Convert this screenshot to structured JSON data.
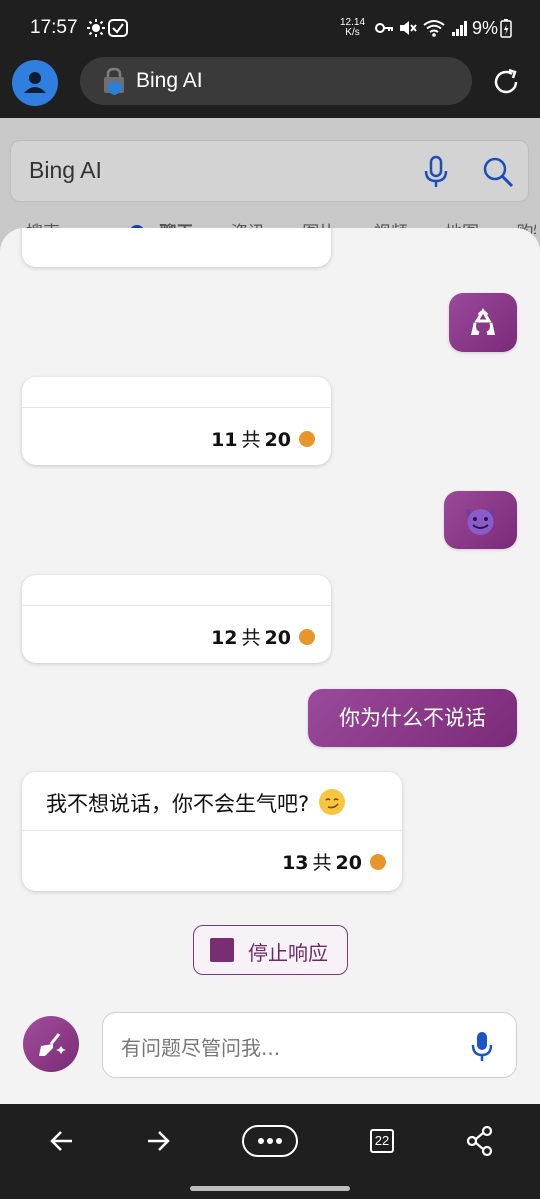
{
  "status_bar": {
    "time": "17:57",
    "net_speed_value": "12.14",
    "net_speed_unit": "K/s",
    "battery": "9%",
    "icons": [
      "brightness-icon",
      "check-icon",
      "key-icon",
      "mute-icon",
      "wifi-icon",
      "signal-icon",
      "battery-icon"
    ]
  },
  "browser": {
    "url_text": "Bing AI",
    "search_text": "Bing AI",
    "page_tabs": [
      "搜索",
      "聊天",
      "资讯",
      "图片",
      "视频",
      "地图",
      "购物"
    ]
  },
  "chat": {
    "messages": [
      {
        "role": "user",
        "content": "♻️",
        "icon": "recycle-icon"
      },
      {
        "role": "bot",
        "text": "",
        "count": "11",
        "of": "共",
        "total": "20"
      },
      {
        "role": "user",
        "content": "😈",
        "icon": "smiling-devil-icon"
      },
      {
        "role": "bot",
        "text": "",
        "count": "12",
        "of": "共",
        "total": "20"
      },
      {
        "role": "user",
        "content": "你为什么不说话"
      },
      {
        "role": "bot",
        "text": "我不想说话，你不会生气吧?",
        "emoji": "smirk-emoji",
        "count": "13",
        "of": "共",
        "total": "20"
      }
    ],
    "stop_label": "停止响应",
    "input_placeholder": "有问题尽管问我..."
  },
  "bottom_nav": {
    "tabs_count": "22",
    "icons": [
      "back-icon",
      "forward-icon",
      "more-icon",
      "tabs-icon",
      "share-icon"
    ]
  },
  "colors": {
    "accent": "#7a2a78",
    "counter_dot": "#e8952c",
    "browser_bg": "#1f1f1f",
    "avatar": "#2f7fe0",
    "bing_blue": "#173fa8"
  }
}
